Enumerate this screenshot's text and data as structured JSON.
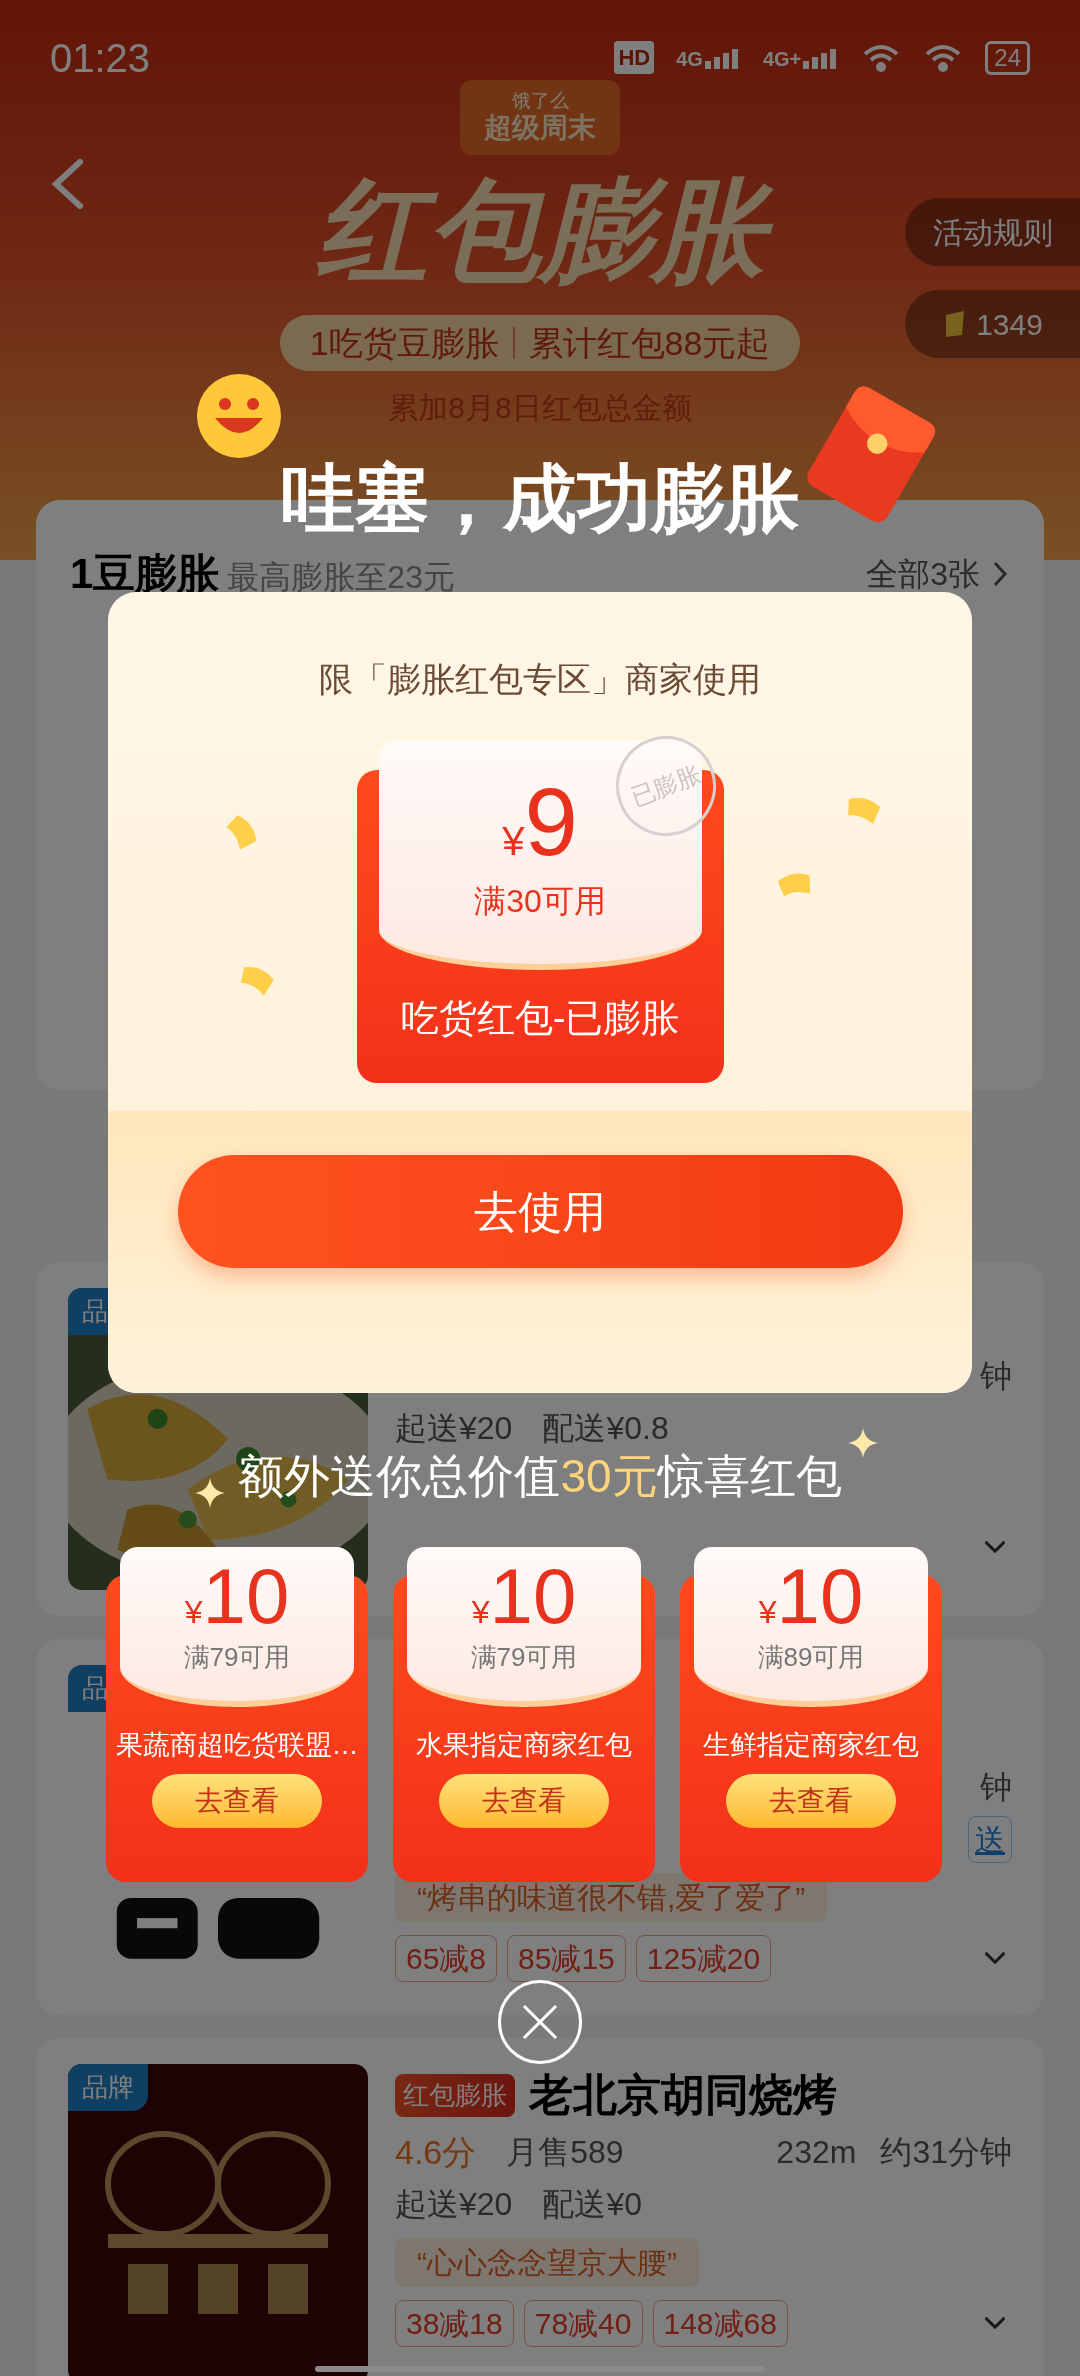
{
  "status_bar": {
    "time": "01:23",
    "sim_badge": "HD",
    "networks": [
      "4G",
      "4G+"
    ],
    "battery": "24"
  },
  "header": {
    "brand": "饿了么",
    "event": "超级周末",
    "title": "红包膨胀",
    "pill_left": "1吃货豆膨胀",
    "pill_right": "累计红包88元起",
    "note": "累加8月8日红包总金额"
  },
  "side_buttons": [
    {
      "kind": "text",
      "label": "活动规则"
    },
    {
      "kind": "coins",
      "label": "1349"
    }
  ],
  "bean_section": {
    "title": "1豆膨胀",
    "subtitle": "最高膨胀至23元",
    "link": "全部3张"
  },
  "stores": [
    {
      "badge": "品",
      "time": "钟",
      "min_order": "起送¥20",
      "delivery_fee": "配送¥0.8"
    },
    {
      "badge": "品",
      "time": "钟",
      "extra": "送",
      "quote": "“烤串的味道很不错,爱了爱了”",
      "discounts": [
        "65减8",
        "85减15",
        "125减20"
      ]
    },
    {
      "badge": "品牌",
      "tag": "红包膨胀",
      "name": "老北京胡同烧烤",
      "rating": "4.6分",
      "sales": "月售589",
      "distance": "232m",
      "time": "约31分钟",
      "min_order": "起送¥20",
      "delivery_fee": "配送¥0",
      "quote": "“心心念念望京大腰”",
      "discounts": [
        "38减18",
        "78减40",
        "148减68"
      ]
    }
  ],
  "popup": {
    "headline": "哇塞，成功膨胀",
    "restriction": "限「膨胀红包专区」商家使用",
    "coupon": {
      "currency": "¥",
      "amount": "9",
      "condition": "满30可用",
      "name": "吃货红包-已膨胀",
      "stamp": "已膨胀"
    },
    "button": "去使用",
    "bonus_before": "额外送你总价值",
    "bonus_highlight": "30元",
    "bonus_after": "惊喜红包",
    "bonus_coupons": [
      {
        "currency": "¥",
        "amount": "10",
        "condition": "满79可用",
        "name": "果蔬商超吃货联盟…",
        "button": "去查看"
      },
      {
        "currency": "¥",
        "amount": "10",
        "condition": "满79可用",
        "name": "水果指定商家红包",
        "button": "去查看"
      },
      {
        "currency": "¥",
        "amount": "10",
        "condition": "满89可用",
        "name": "生鲜指定商家红包",
        "button": "去查看"
      }
    ]
  }
}
